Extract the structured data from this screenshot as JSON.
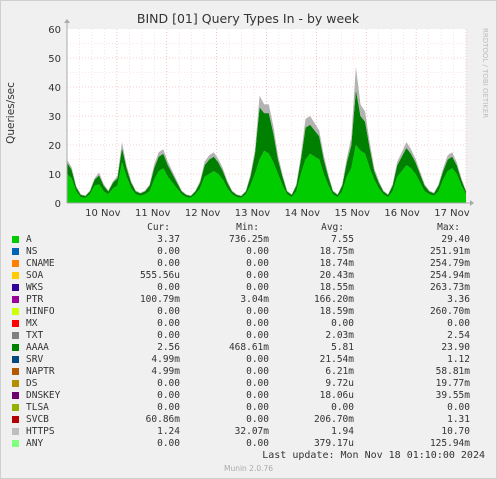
{
  "chart_data": {
    "type": "area",
    "title": "BIND [01] Query Types In - by week",
    "ylabel": "Queries/sec",
    "ylim": [
      0,
      60
    ],
    "yticks": [
      "0",
      "10",
      "20",
      "30",
      "40",
      "50",
      "60"
    ],
    "xticks": [
      "10 Nov",
      "11 Nov",
      "12 Nov",
      "13 Nov",
      "14 Nov",
      "15 Nov",
      "16 Nov",
      "17 Nov"
    ],
    "x_days": [
      0,
      8
    ],
    "grid": true,
    "watermark": "RRDTOOL / TOBI OETIKER",
    "series": [
      {
        "name": "A",
        "color": "#00cc00",
        "values": [
          10,
          8.5,
          4,
          2,
          1.8,
          3,
          6,
          6.5,
          4,
          3,
          5,
          6,
          14,
          9,
          5,
          3,
          2.5,
          3,
          4,
          8,
          11,
          12,
          9,
          7,
          5,
          3,
          2,
          1.8,
          3,
          5,
          9,
          10,
          11,
          10,
          8,
          5,
          3,
          2,
          1.8,
          3,
          6,
          10,
          15,
          18,
          17,
          14,
          10,
          6,
          3,
          2,
          4,
          10,
          15,
          17,
          16,
          15,
          10,
          6,
          3,
          2,
          4,
          9,
          12,
          20,
          18,
          17,
          12,
          8,
          5,
          3,
          2,
          4,
          9,
          11,
          13,
          12,
          10,
          7,
          4,
          3,
          2.5,
          4,
          8,
          11,
          12,
          10,
          6,
          3
        ]
      },
      {
        "name": "AAAA",
        "color": "#008000",
        "values": [
          4,
          3,
          1.5,
          0.8,
          0.6,
          1,
          2,
          3,
          2,
          1,
          2,
          2.5,
          5,
          3,
          2,
          1,
          0.8,
          1,
          2,
          4,
          5,
          5,
          4,
          3,
          2,
          1,
          0.8,
          0.6,
          1,
          2,
          4,
          5,
          5,
          4,
          3,
          2,
          1,
          0.8,
          0.6,
          1,
          3,
          7,
          18,
          13,
          14,
          10,
          5,
          3,
          1,
          0.8,
          2,
          5,
          11,
          10,
          9,
          8,
          5,
          3,
          1,
          0.8,
          2,
          5,
          8,
          19,
          12,
          11,
          7,
          3,
          2,
          1,
          0.8,
          2,
          4,
          5,
          6,
          5,
          4,
          3,
          2,
          1,
          0.8,
          2,
          3,
          4,
          4,
          3,
          2,
          1
        ]
      },
      {
        "name": "HTTPS",
        "color": "#b3b3b3",
        "values": [
          1,
          0.8,
          0.4,
          0.2,
          0.2,
          0.3,
          0.6,
          1,
          0.6,
          0.3,
          0.5,
          0.8,
          2,
          1,
          0.6,
          0.3,
          0.2,
          0.3,
          0.5,
          1.2,
          1.5,
          1.5,
          1.2,
          0.9,
          0.6,
          0.3,
          0.2,
          0.2,
          0.3,
          0.6,
          1.2,
          1.5,
          1.5,
          1.2,
          0.9,
          0.6,
          0.3,
          0.2,
          0.2,
          0.3,
          0.8,
          1.5,
          4,
          3,
          3,
          2.5,
          1.5,
          0.8,
          0.3,
          0.2,
          0.5,
          1.5,
          3,
          3,
          2.5,
          2,
          1.5,
          0.8,
          0.3,
          0.2,
          0.5,
          1.5,
          2.5,
          8,
          4,
          3.5,
          2,
          1,
          0.6,
          0.3,
          0.2,
          0.5,
          1.2,
          1.5,
          2,
          1.5,
          1.2,
          0.8,
          0.5,
          0.3,
          0.2,
          0.5,
          1,
          1.5,
          1.5,
          1,
          0.6,
          0.3
        ]
      }
    ],
    "legend_columns": [
      "Cur:",
      "Min:",
      "Avg:",
      "Max:"
    ],
    "legend": [
      {
        "name": "A",
        "color": "#00cc00",
        "cur": "3.37",
        "min": "736.25m",
        "avg": "7.55",
        "max": "29.40"
      },
      {
        "name": "NS",
        "color": "#0066b3",
        "cur": "0.00",
        "min": "0.00",
        "avg": "18.75m",
        "max": "251.91m"
      },
      {
        "name": "CNAME",
        "color": "#ff8000",
        "cur": "0.00",
        "min": "0.00",
        "avg": "18.74m",
        "max": "254.79m"
      },
      {
        "name": "SOA",
        "color": "#ffcc00",
        "cur": "555.56u",
        "min": "0.00",
        "avg": "20.43m",
        "max": "254.94m"
      },
      {
        "name": "WKS",
        "color": "#330099",
        "cur": "0.00",
        "min": "0.00",
        "avg": "18.55m",
        "max": "263.73m"
      },
      {
        "name": "PTR",
        "color": "#990099",
        "cur": "100.79m",
        "min": "3.04m",
        "avg": "166.20m",
        "max": "3.36"
      },
      {
        "name": "HINFO",
        "color": "#ccff00",
        "cur": "0.00",
        "min": "0.00",
        "avg": "18.59m",
        "max": "260.70m"
      },
      {
        "name": "MX",
        "color": "#ff0000",
        "cur": "0.00",
        "min": "0.00",
        "avg": "0.00",
        "max": "0.00"
      },
      {
        "name": "TXT",
        "color": "#808080",
        "cur": "0.00",
        "min": "0.00",
        "avg": "2.03m",
        "max": "2.54"
      },
      {
        "name": "AAAA",
        "color": "#008000",
        "cur": "2.56",
        "min": "468.61m",
        "avg": "5.81",
        "max": "23.90"
      },
      {
        "name": "SRV",
        "color": "#00487d",
        "cur": "4.99m",
        "min": "0.00",
        "avg": "21.54m",
        "max": "1.12"
      },
      {
        "name": "NAPTR",
        "color": "#b35a00",
        "cur": "4.99m",
        "min": "0.00",
        "avg": "6.21m",
        "max": "58.81m"
      },
      {
        "name": "DS",
        "color": "#b38f00",
        "cur": "0.00",
        "min": "0.00",
        "avg": "9.72u",
        "max": "19.77m"
      },
      {
        "name": "DNSKEY",
        "color": "#6b006b",
        "cur": "0.00",
        "min": "0.00",
        "avg": "18.06u",
        "max": "39.55m"
      },
      {
        "name": "TLSA",
        "color": "#8fb300",
        "cur": "0.00",
        "min": "0.00",
        "avg": "0.00",
        "max": "0.00"
      },
      {
        "name": "SVCB",
        "color": "#b30000",
        "cur": "60.86m",
        "min": "0.00",
        "avg": "206.70m",
        "max": "1.31"
      },
      {
        "name": "HTTPS",
        "color": "#bebebe",
        "cur": "1.24",
        "min": "32.07m",
        "avg": "1.94",
        "max": "10.70"
      },
      {
        "name": "ANY",
        "color": "#80ff80",
        "cur": "0.00",
        "min": "0.00",
        "avg": "379.17u",
        "max": "125.94m"
      }
    ],
    "last_update": "Last update: Mon Nov 18 01:10:00 2024",
    "footer": "Munin 2.0.76"
  }
}
